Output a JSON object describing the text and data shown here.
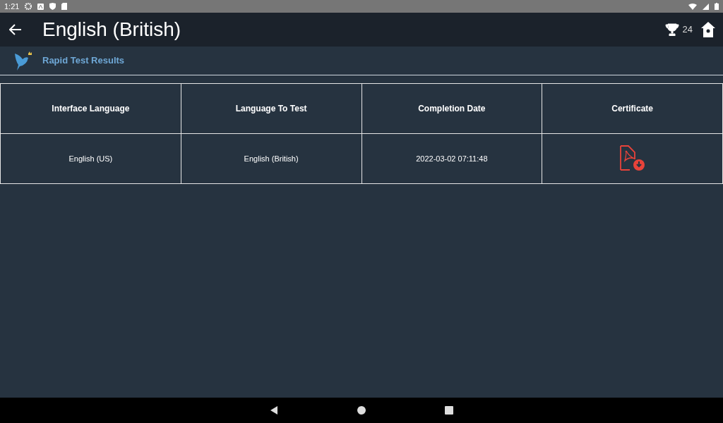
{
  "status_bar": {
    "time": "1:21"
  },
  "app_bar": {
    "title": "English (British)",
    "trophy_count": "24"
  },
  "subheader": {
    "title": "Rapid Test Results"
  },
  "table": {
    "columns": [
      "Interface Language",
      "Language To Test",
      "Completion Date",
      "Certificate"
    ],
    "rows": [
      {
        "cells": [
          "English (US)",
          "English (British)",
          "2022-03-02 07:11:48"
        ]
      }
    ]
  }
}
